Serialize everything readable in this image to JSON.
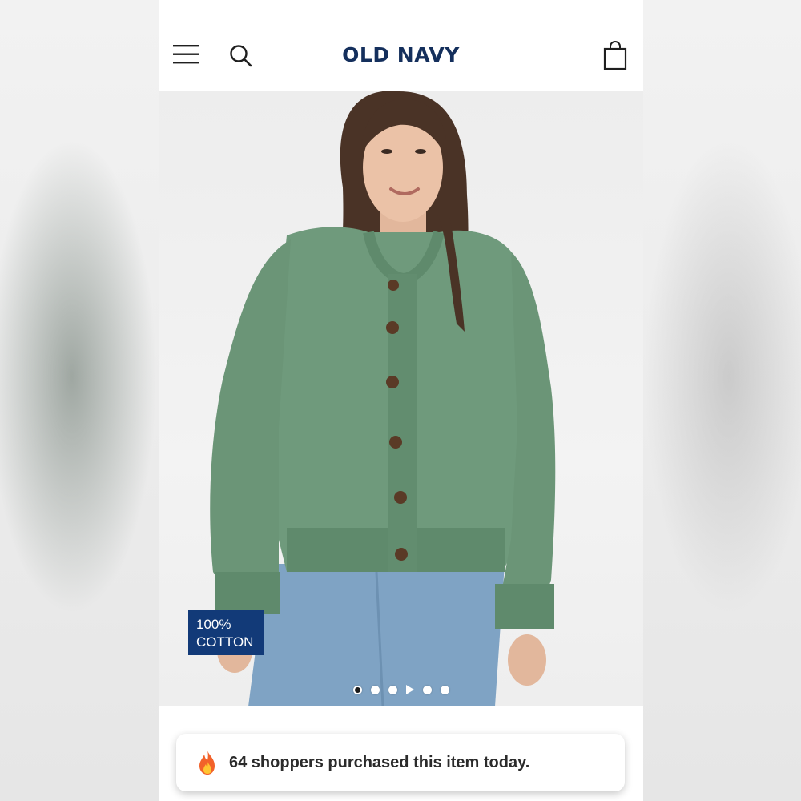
{
  "header": {
    "brand": "OLD NAVY",
    "icons": {
      "menu": "hamburger-menu-icon",
      "search": "search-icon",
      "bag": "shopping-bag-icon"
    }
  },
  "product": {
    "badge_line1": "100%",
    "badge_line2": "COTTON",
    "carousel": {
      "total_slides": 6,
      "active_index": 0,
      "video_slide_index": 3
    }
  },
  "toast": {
    "icon": "fire-icon",
    "message": "64 shoppers purchased this item today."
  },
  "colors": {
    "brand": "#142f5c",
    "badge": "#123a78",
    "sweater": "#6f9a7c"
  }
}
